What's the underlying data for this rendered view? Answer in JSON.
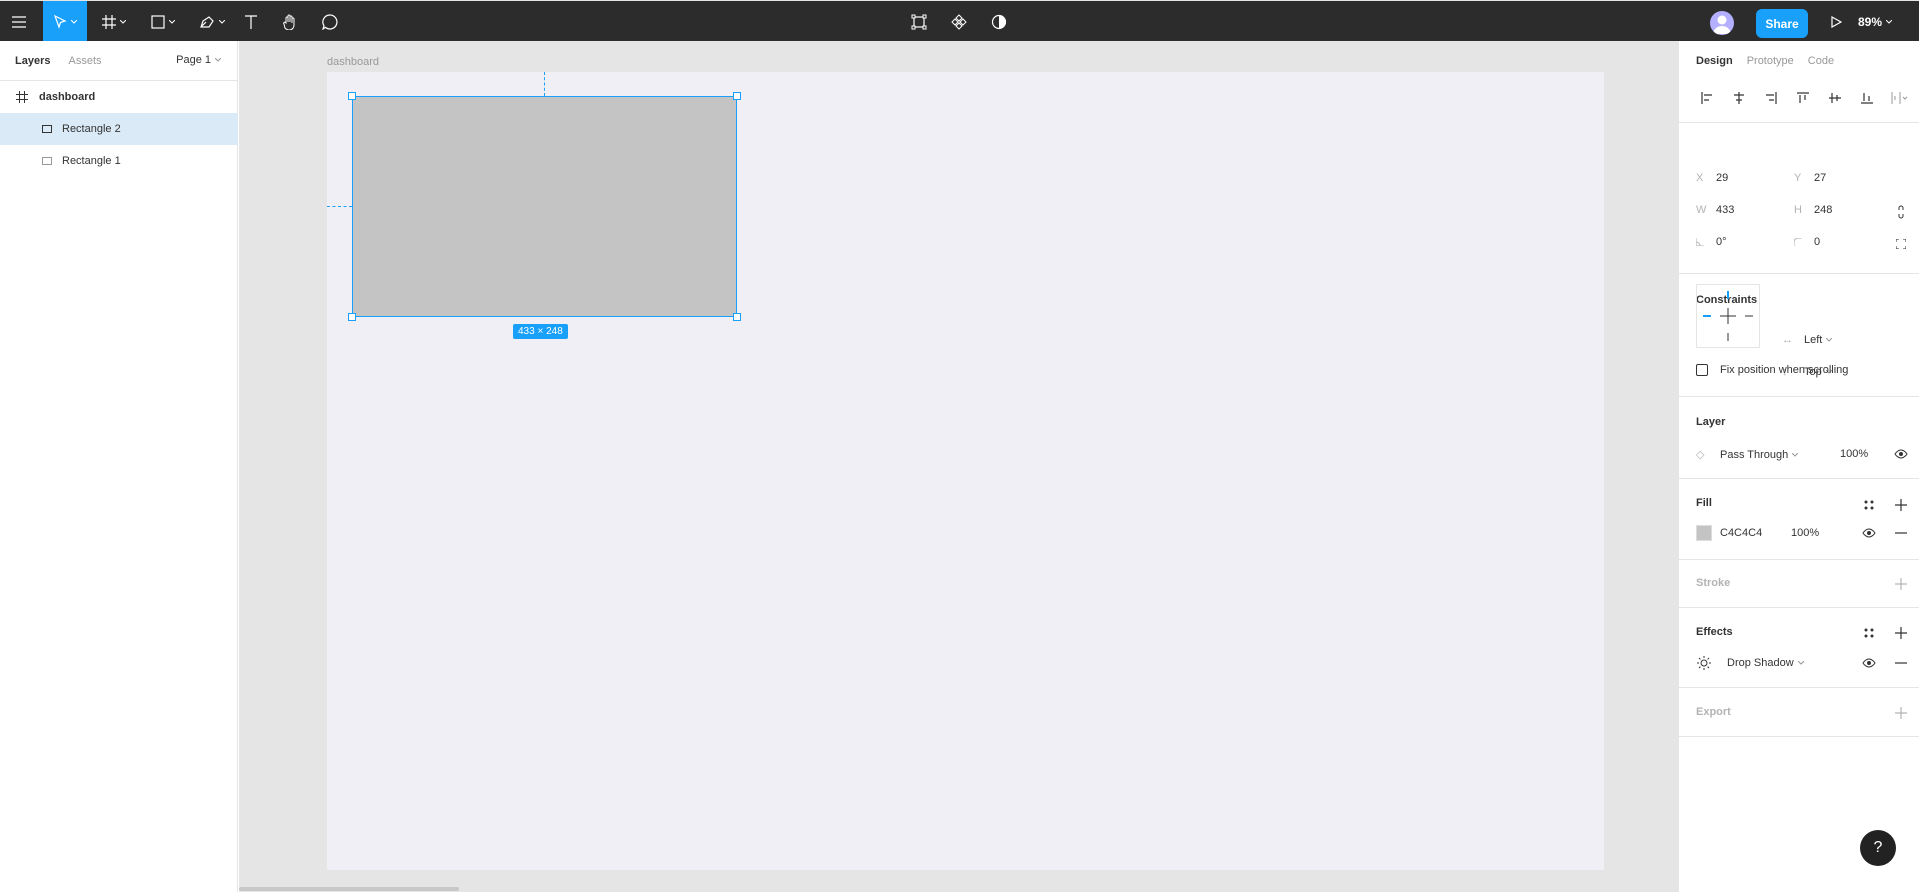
{
  "toolbar": {
    "zoom": "89%",
    "share_label": "Share"
  },
  "left_panel": {
    "tabs": [
      "Layers",
      "Assets"
    ],
    "page_selector": "Page 1",
    "layers": [
      {
        "name": "dashboard",
        "type": "frame"
      },
      {
        "name": "Rectangle 2",
        "type": "rectangle",
        "selected": true
      },
      {
        "name": "Rectangle 1",
        "type": "rectangle",
        "selected": false
      }
    ]
  },
  "canvas": {
    "frame_name": "dashboard",
    "selection_size": "433 × 248",
    "rect_fill": "#C4C4C4",
    "selection_color": "#18A0FB"
  },
  "right_panel": {
    "tabs": [
      "Design",
      "Prototype",
      "Code"
    ],
    "position": {
      "x_label": "X",
      "x": "29",
      "y_label": "Y",
      "y": "27"
    },
    "size": {
      "w_label": "W",
      "w": "433",
      "h_label": "H",
      "h": "248"
    },
    "rotation": "0°",
    "corner_radius": "0",
    "constraints": {
      "title": "Constraints",
      "horizontal": "Left",
      "vertical": "Top",
      "fix_position_label": "Fix position when scrolling"
    },
    "layer": {
      "title": "Layer",
      "blend_mode": "Pass Through",
      "opacity": "100%"
    },
    "fill": {
      "title": "Fill",
      "hex": "C4C4C4",
      "opacity": "100%"
    },
    "stroke": {
      "title": "Stroke"
    },
    "effects": {
      "title": "Effects",
      "effect": "Drop Shadow"
    },
    "export": {
      "title": "Export"
    }
  },
  "help": "?"
}
